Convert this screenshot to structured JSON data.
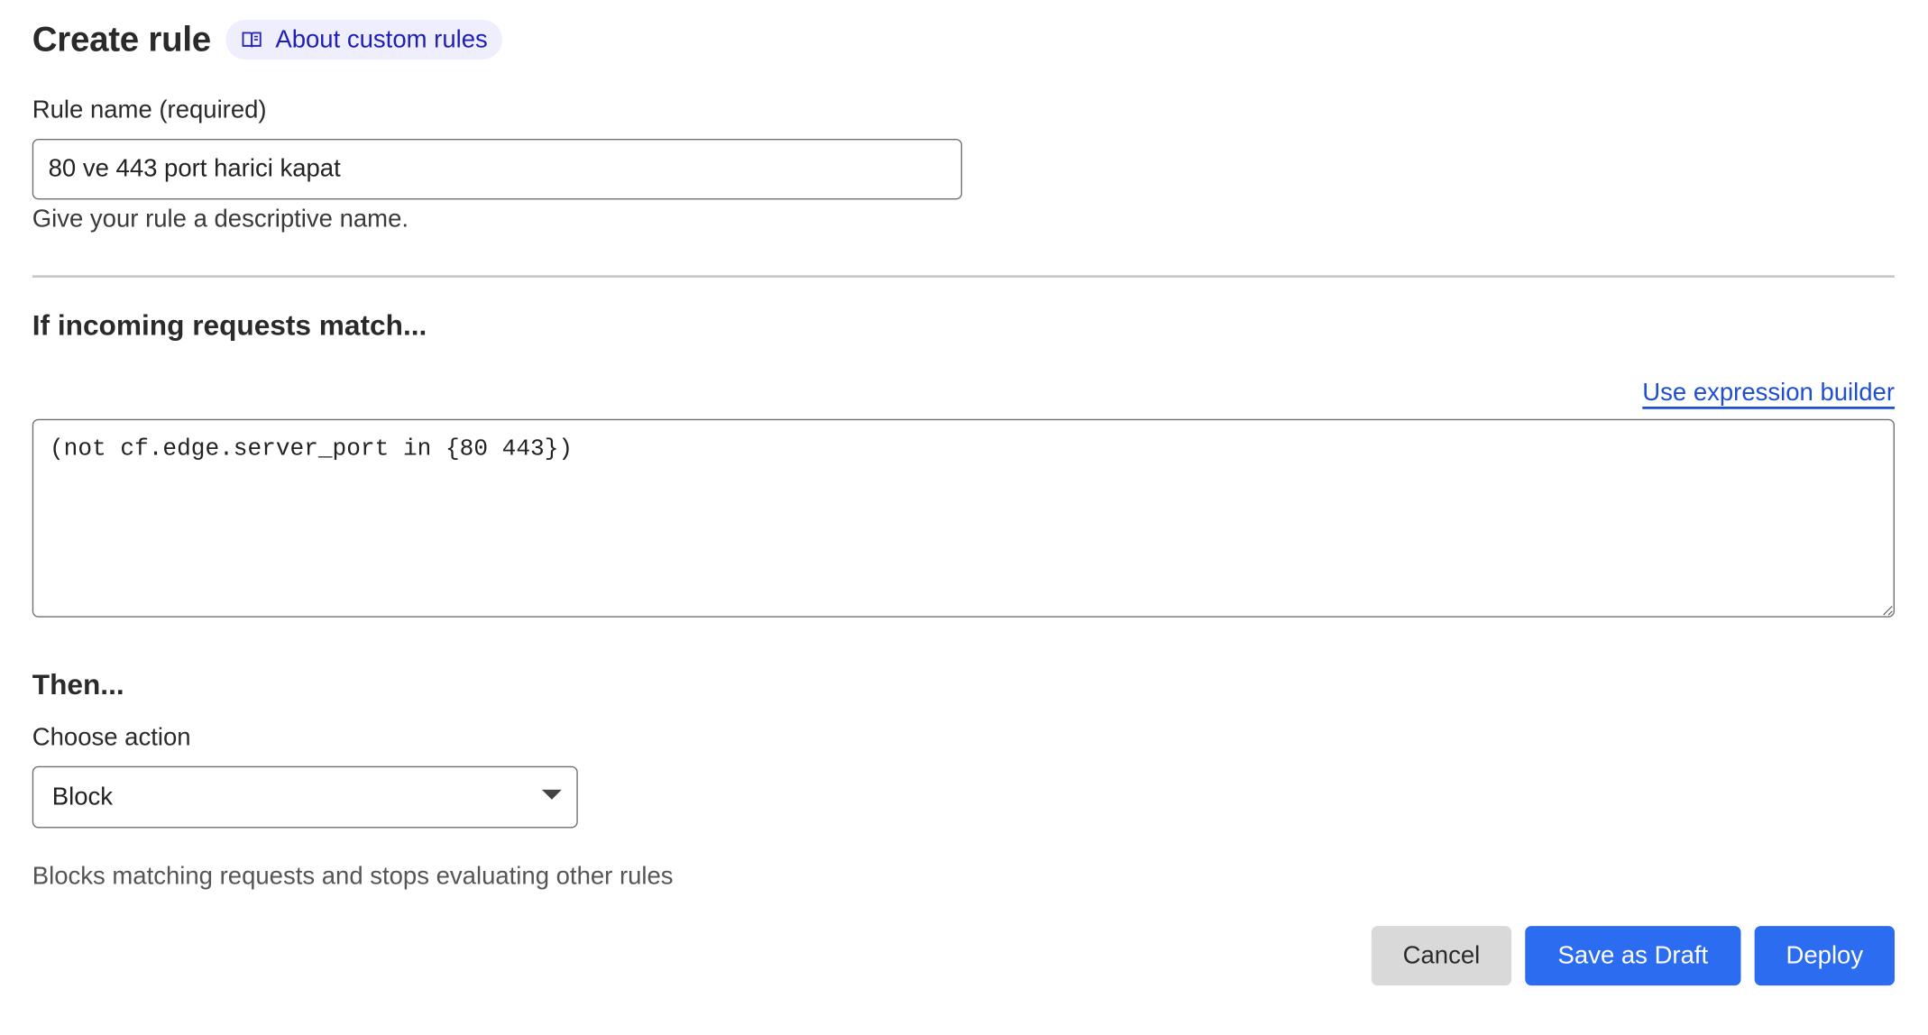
{
  "header": {
    "title": "Create rule",
    "about_link": "About custom rules",
    "about_icon": "book-icon"
  },
  "rule_name": {
    "label": "Rule name (required)",
    "value": "80 ve 443 port harici kapat",
    "hint": "Give your rule a descriptive name."
  },
  "match": {
    "title": "If incoming requests match...",
    "builder_link": "Use expression builder",
    "expression": "(not cf.edge.server_port in {80 443})"
  },
  "then": {
    "title": "Then...",
    "action_label": "Choose action",
    "action_value": "Block",
    "action_description": "Blocks matching requests and stops evaluating other rules"
  },
  "buttons": {
    "cancel": "Cancel",
    "save_draft": "Save as Draft",
    "deploy": "Deploy"
  },
  "colors": {
    "primary": "#2b6cf0",
    "link": "#1f4fd0",
    "pill_bg": "#eeeefc",
    "pill_text": "#1f1fb8"
  }
}
